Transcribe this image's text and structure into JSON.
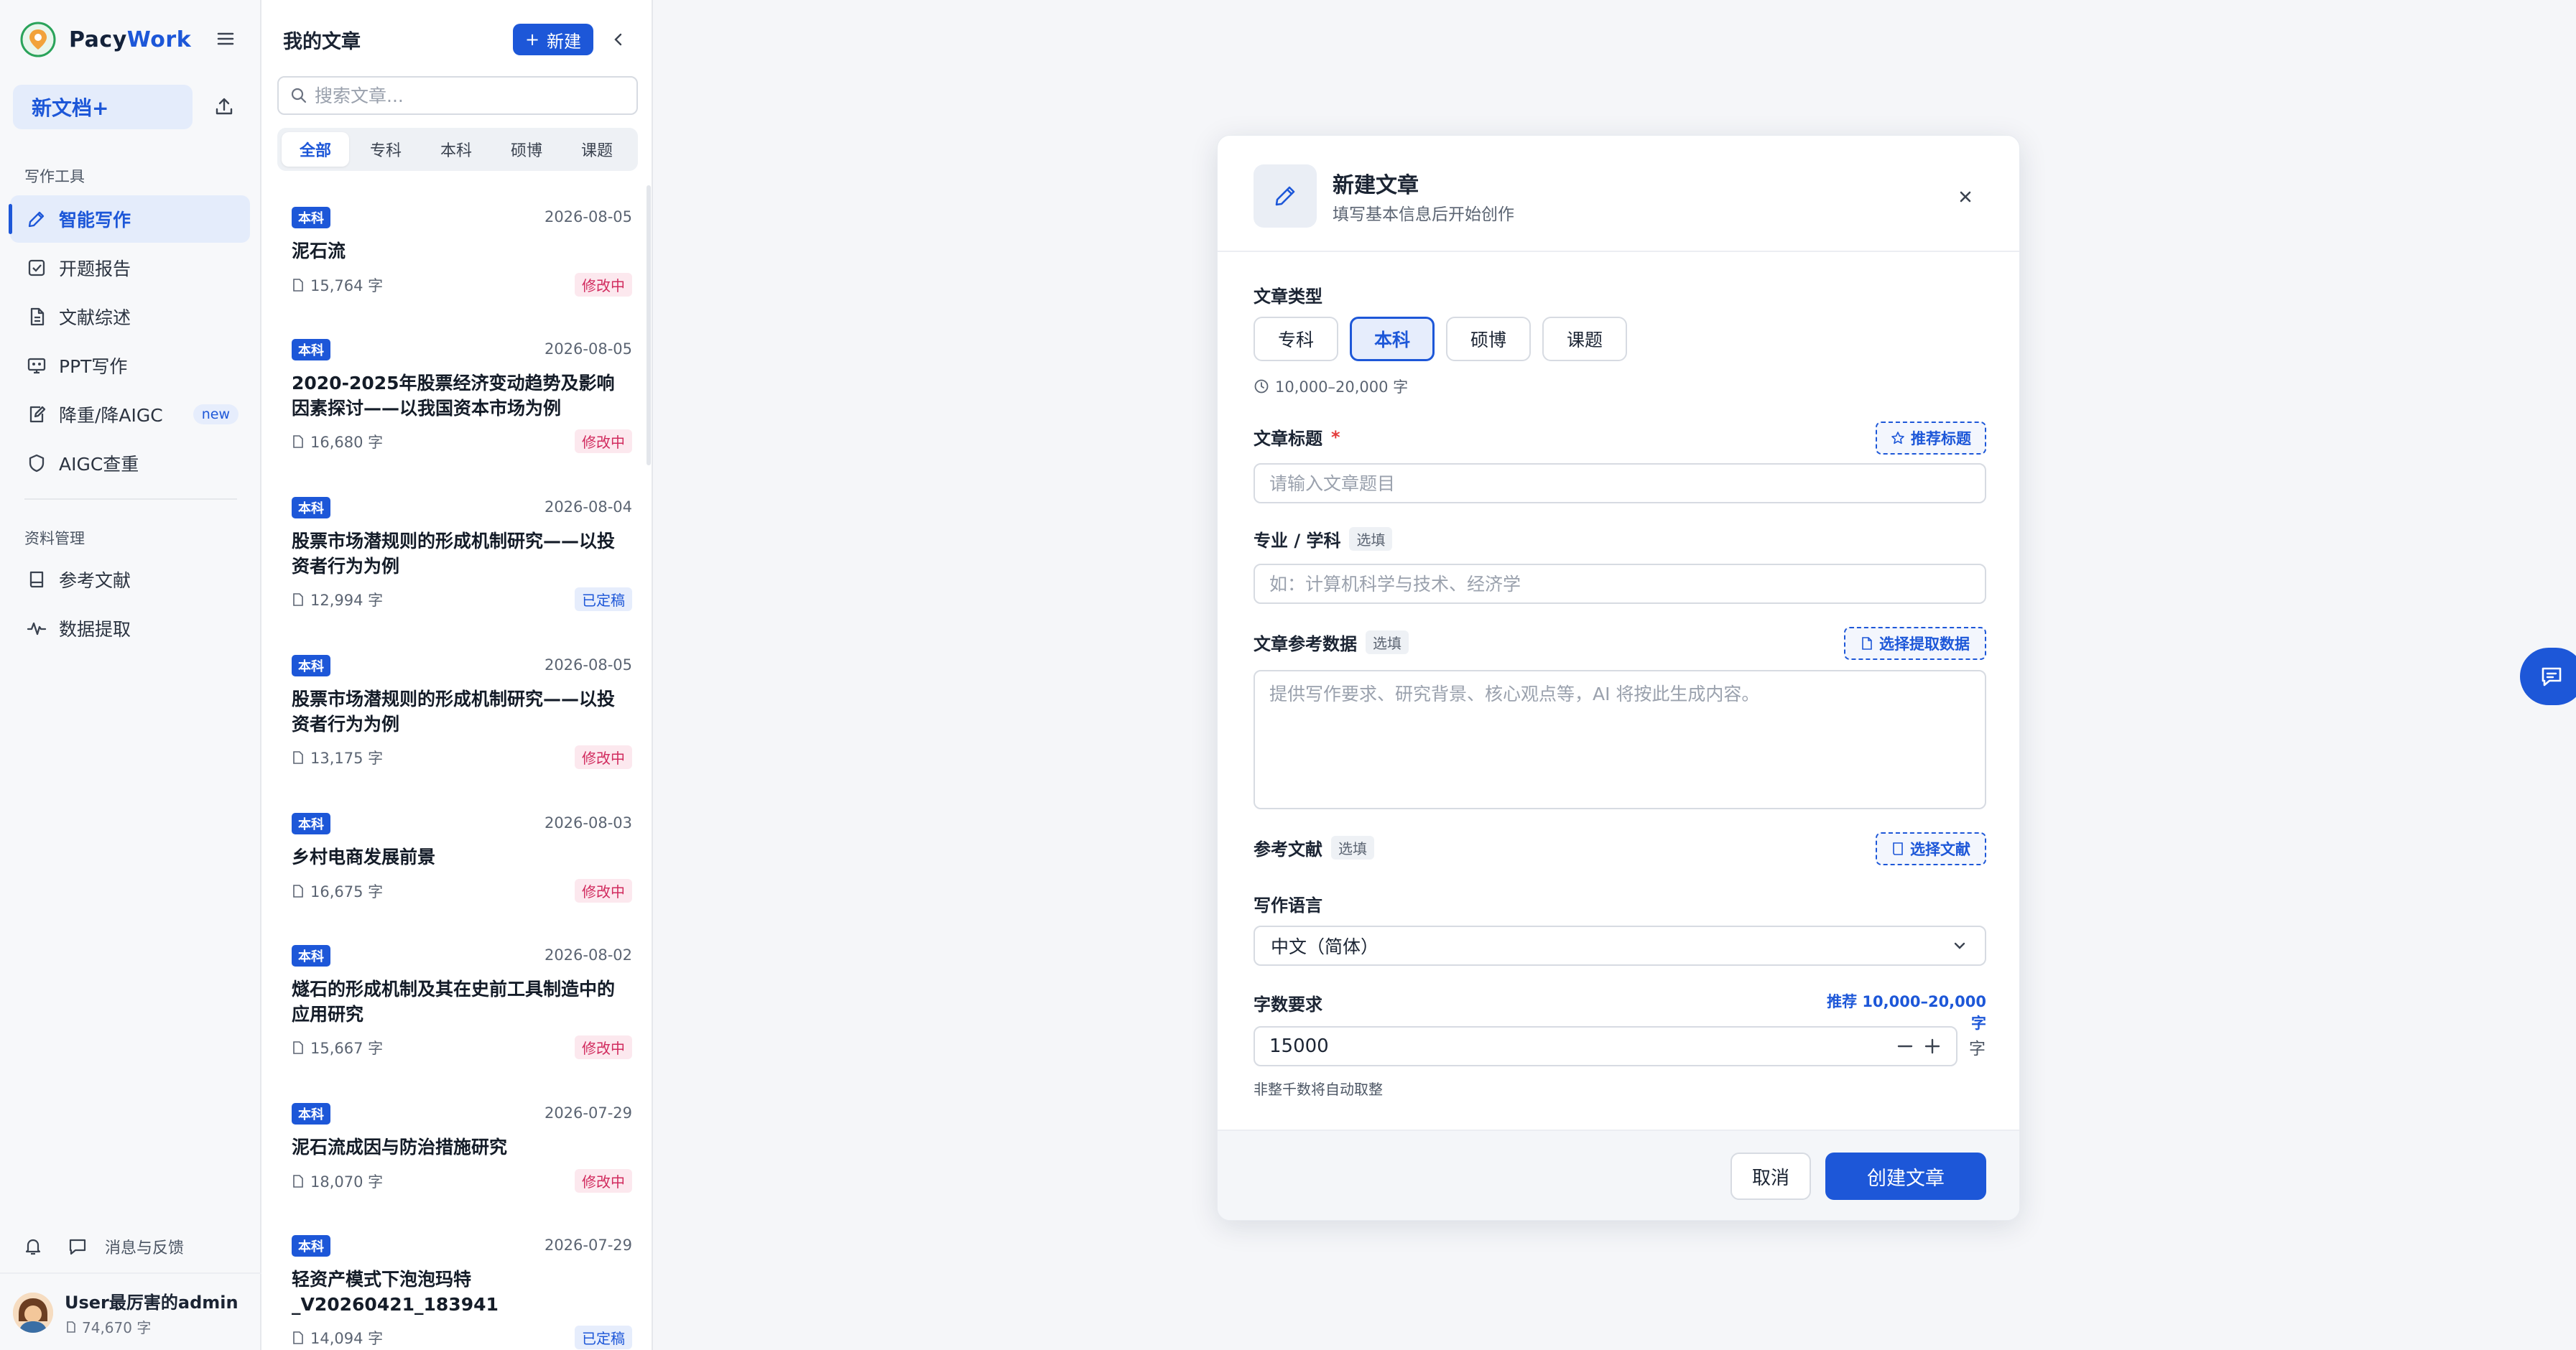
{
  "brand": {
    "name_part1": "Pacy",
    "name_part2": "Work"
  },
  "sidebar": {
    "new_doc_label": "新文档+",
    "section_writing": "写作工具",
    "section_resources": "资料管理",
    "items": [
      {
        "label": "智能写作",
        "icon": "pen-icon"
      },
      {
        "label": "开题报告",
        "icon": "checkbox-icon"
      },
      {
        "label": "文献综述",
        "icon": "document-icon"
      },
      {
        "label": "PPT写作",
        "icon": "presentation-icon"
      },
      {
        "label": "降重/降AIGC",
        "icon": "edit-doc-icon",
        "badge": "new"
      },
      {
        "label": "AIGC查重",
        "icon": "shield-icon"
      },
      {
        "label": "参考文献",
        "icon": "book-icon"
      },
      {
        "label": "数据提取",
        "icon": "activity-icon"
      }
    ],
    "feedback_label": "消息与反馈",
    "user": {
      "name": "User最厉害的admin",
      "words": "74,670 字"
    }
  },
  "articles": {
    "title": "我的文章",
    "new_label": "新建",
    "search_placeholder": "搜索文章...",
    "filters": [
      "全部",
      "专科",
      "本科",
      "硕博",
      "课题"
    ],
    "items": [
      {
        "level": "本科",
        "date": "2026-08-05",
        "title": "泥石流",
        "words": "15,764 字",
        "status": "修改中"
      },
      {
        "level": "本科",
        "date": "2026-08-05",
        "title": "2020-2025年股票经济变动趋势及影响因素探讨——以我国资本市场为例",
        "words": "16,680 字",
        "status": "修改中"
      },
      {
        "level": "本科",
        "date": "2026-08-04",
        "title": "股票市场潜规则的形成机制研究——以投资者行为为例",
        "words": "12,994 字",
        "status": "已定稿"
      },
      {
        "level": "本科",
        "date": "2026-08-05",
        "title": "股票市场潜规则的形成机制研究——以投资者行为为例",
        "words": "13,175 字",
        "status": "修改中"
      },
      {
        "level": "本科",
        "date": "2026-08-03",
        "title": "乡村电商发展前景",
        "words": "16,675 字",
        "status": "修改中"
      },
      {
        "level": "本科",
        "date": "2026-08-02",
        "title": "燧石的形成机制及其在史前工具制造中的应用研究",
        "words": "15,667 字",
        "status": "修改中"
      },
      {
        "level": "本科",
        "date": "2026-07-29",
        "title": "泥石流成因与防治措施研究",
        "words": "18,070 字",
        "status": "修改中"
      },
      {
        "level": "本科",
        "date": "2026-07-29",
        "title": "轻资产模式下泡泡玛特_V20260421_183941",
        "words": "14,094 字",
        "status": "已定稿"
      }
    ]
  },
  "modal": {
    "title": "新建文章",
    "subtitle": "填写基本信息后开始创作",
    "type_label": "文章类型",
    "types": [
      "专科",
      "本科",
      "硕博",
      "课题"
    ],
    "range_hint": "10,000–20,000 字",
    "title_label": "文章标题",
    "required_mark": "*",
    "recommend_title": "推荐标题",
    "title_placeholder": "请输入文章题目",
    "major_label": "专业 / 学科",
    "optional": "选填",
    "major_placeholder": "如：计算机科学与技术、经济学",
    "ref_data_label": "文章参考数据",
    "select_data": "选择提取数据",
    "ref_data_placeholder": "提供写作要求、研究背景、核心观点等，AI 将按此生成内容。",
    "refs_label": "参考文献",
    "select_refs": "选择文献",
    "lang_label": "写作语言",
    "lang_value": "中文（简体）",
    "words_label": "字数要求",
    "words_recommend": "推荐 10,000–20,000 字",
    "words_value": "15000",
    "words_unit": "字",
    "words_note": "非整千数将自动取整",
    "cancel": "取消",
    "create": "创建文章"
  },
  "colors": {
    "accent": "#1d57d8",
    "editing": "#d12b5e",
    "background": "#f5f6f9"
  }
}
